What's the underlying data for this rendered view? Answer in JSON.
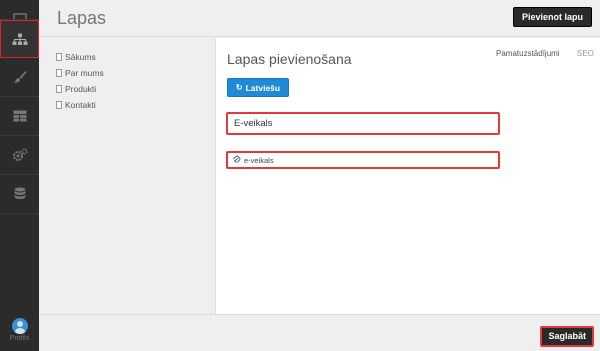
{
  "sidebar": {
    "items": [
      {
        "icon": "monitor-icon"
      },
      {
        "icon": "sitemap-icon"
      },
      {
        "icon": "brush-icon"
      },
      {
        "icon": "layout-icon"
      },
      {
        "icon": "gears-icon"
      },
      {
        "icon": "database-icon"
      }
    ],
    "profile_label": "Profils"
  },
  "header": {
    "title": "Lapas",
    "add_button": "Pievienot lapu"
  },
  "tree": {
    "items": [
      "Sākums",
      "Par mums",
      "Produkti",
      "Kontakti"
    ]
  },
  "editor": {
    "form_title": "Lapas pievienošana",
    "tabs": [
      "Pamatuzstādījumi",
      "SEO"
    ],
    "language_button": "Latviešu",
    "title_value": "E-veikals",
    "slug_value": "e-veikals"
  },
  "footer": {
    "save_button": "Saglabāt"
  },
  "colors": {
    "sidebar_bg": "#2b2b2b",
    "accent_blue": "#1f8ad6",
    "highlight_red": "#e03a3a"
  }
}
